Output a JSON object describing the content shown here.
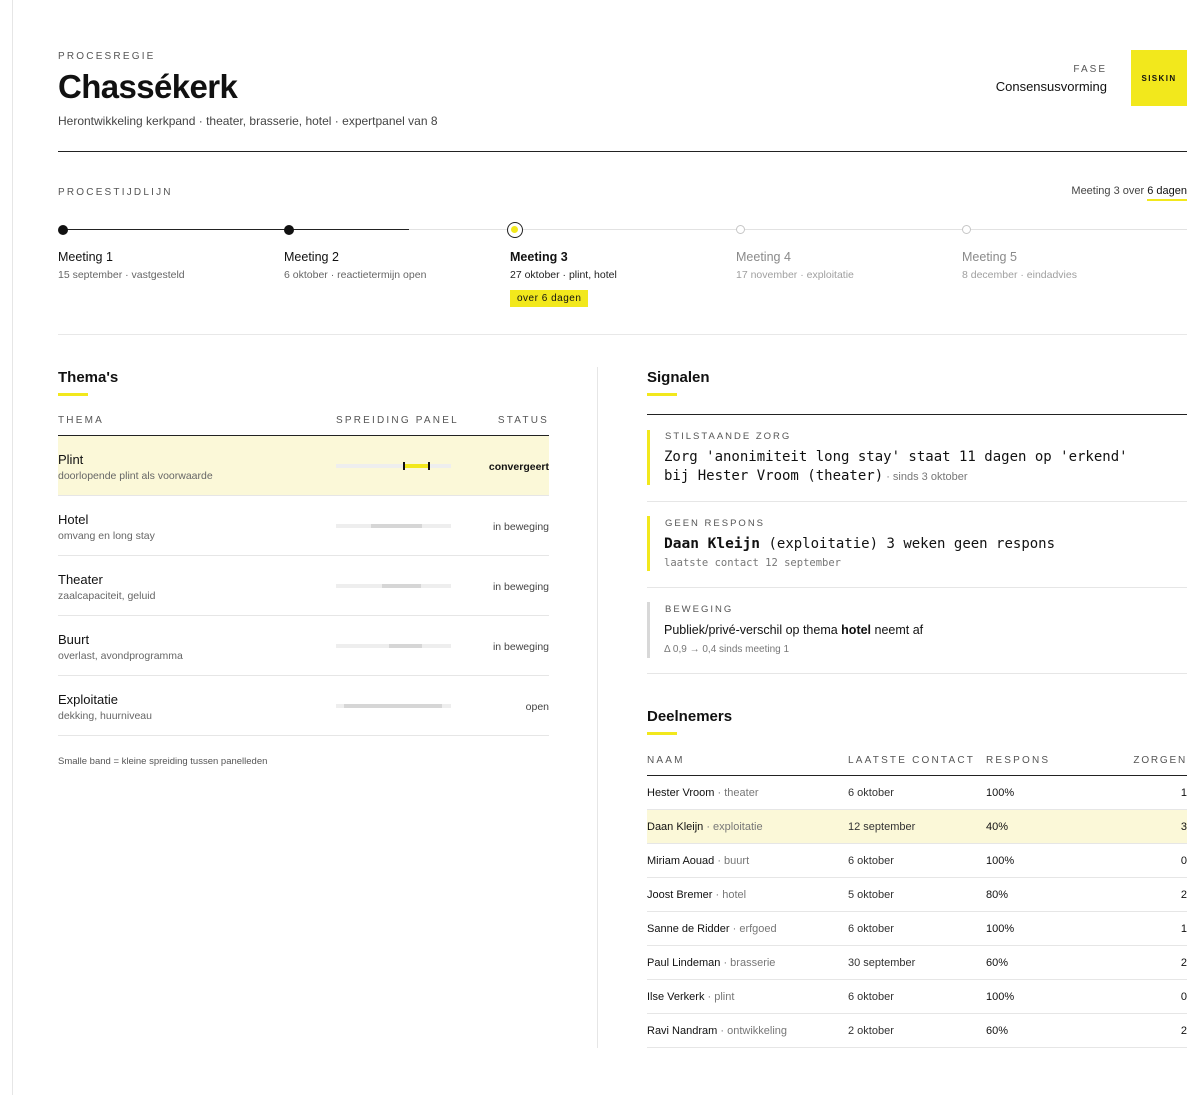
{
  "header": {
    "eyebrow": "PROCESREGIE",
    "title": "Chassékerk",
    "subtitle": "Herontwikkeling kerkpand · theater, brasserie, hotel · expertpanel van 8",
    "fase_label": "FASE",
    "fase_value": "Consensusvorming",
    "logo_text": "SISKIN"
  },
  "timeline": {
    "caption": "PROCESTIJDLIJN",
    "next_prefix": "Meeting 3 over ",
    "next_highlight": "6 dagen",
    "meetings": [
      {
        "name": "Meeting 1",
        "date": "15 september · vastgesteld",
        "state": "done"
      },
      {
        "name": "Meeting 2",
        "date": "6 oktober · reactietermijn open",
        "state": "done"
      },
      {
        "name": "Meeting 3",
        "date": "27 oktober · plint, hotel",
        "state": "current",
        "badge": "over 6 dagen"
      },
      {
        "name": "Meeting 4",
        "date": "17 november · exploitatie",
        "state": "future"
      },
      {
        "name": "Meeting 5",
        "date": "8 december · eindadvies",
        "state": "future"
      }
    ]
  },
  "themes": {
    "title": "Thema's",
    "col_theme": "THEMA",
    "col_spread": "SPREIDING PANEL",
    "col_status": "STATUS",
    "rows": [
      {
        "name": "Plint",
        "sub": "doorlopende plint als voorwaarde",
        "status": "convergeert",
        "spread_from": 0.58,
        "spread_to": 0.81,
        "marks": [
          0.58,
          0.8
        ]
      },
      {
        "name": "Hotel",
        "sub": "omvang en long stay",
        "status": "in beweging",
        "spread_from": 0.3,
        "spread_to": 0.74
      },
      {
        "name": "Theater",
        "sub": "zaalcapaciteit, geluid",
        "status": "in beweging",
        "spread_from": 0.4,
        "spread_to": 0.74
      },
      {
        "name": "Buurt",
        "sub": "overlast, avondprogramma",
        "status": "in beweging",
        "spread_from": 0.46,
        "spread_to": 0.75
      },
      {
        "name": "Exploitatie",
        "sub": "dekking, huurniveau",
        "status": "open",
        "spread_from": 0.07,
        "spread_to": 0.92
      }
    ],
    "footnote": "Smalle band = kleine spreiding tussen panelleden"
  },
  "signals": {
    "title": "Signalen",
    "items": [
      {
        "caption": "STILSTAANDE ZORG",
        "line1": "Zorg 'anonimiteit long stay' staat 11 dagen op 'erkend'",
        "line2": "bij Hester Vroom (theater)",
        "since": " · sinds 3 oktober"
      },
      {
        "caption": "GEEN RESPONS",
        "name": "Daan Kleijn",
        "rest": " (exploitatie) 3 weken geen respons",
        "last_contact": "laatste contact 12 september"
      },
      {
        "caption": "BEWEGING",
        "text_before": "Publiek/privé-verschil op thema ",
        "text_bold": "hotel",
        "text_after": " neemt af",
        "delta": "Δ 0,9 → 0,4 sinds meeting 1"
      }
    ]
  },
  "participants": {
    "title": "Deelnemers",
    "col_name": "NAAM",
    "col_contact": "LAATSTE CONTACT",
    "col_response": "RESPONS",
    "col_concerns": "ZORGEN",
    "rows": [
      {
        "name": "Hester Vroom",
        "role": "theater",
        "contact": "6 oktober",
        "response": "100%",
        "concerns": "1"
      },
      {
        "name": "Daan Kleijn",
        "role": "exploitatie",
        "contact": "12 september",
        "response": "40%",
        "concerns": "3"
      },
      {
        "name": "Miriam Aouad",
        "role": "buurt",
        "contact": "6 oktober",
        "response": "100%",
        "concerns": "0"
      },
      {
        "name": "Joost Bremer",
        "role": "hotel",
        "contact": "5 oktober",
        "response": "80%",
        "concerns": "2"
      },
      {
        "name": "Sanne de Ridder",
        "role": "erfgoed",
        "contact": "6 oktober",
        "response": "100%",
        "concerns": "1"
      },
      {
        "name": "Paul Lindeman",
        "role": "brasserie",
        "contact": "30 september",
        "response": "60%",
        "concerns": "2"
      },
      {
        "name": "Ilse Verkerk",
        "role": "plint",
        "contact": "6 oktober",
        "response": "100%",
        "concerns": "0"
      },
      {
        "name": "Ravi Nandram",
        "role": "ontwikkeling",
        "contact": "2 oktober",
        "response": "60%",
        "concerns": "2"
      }
    ]
  },
  "colors": {
    "accent": "#f2e81c",
    "highlight_row": "#fbf8d8",
    "ink": "#111111"
  }
}
